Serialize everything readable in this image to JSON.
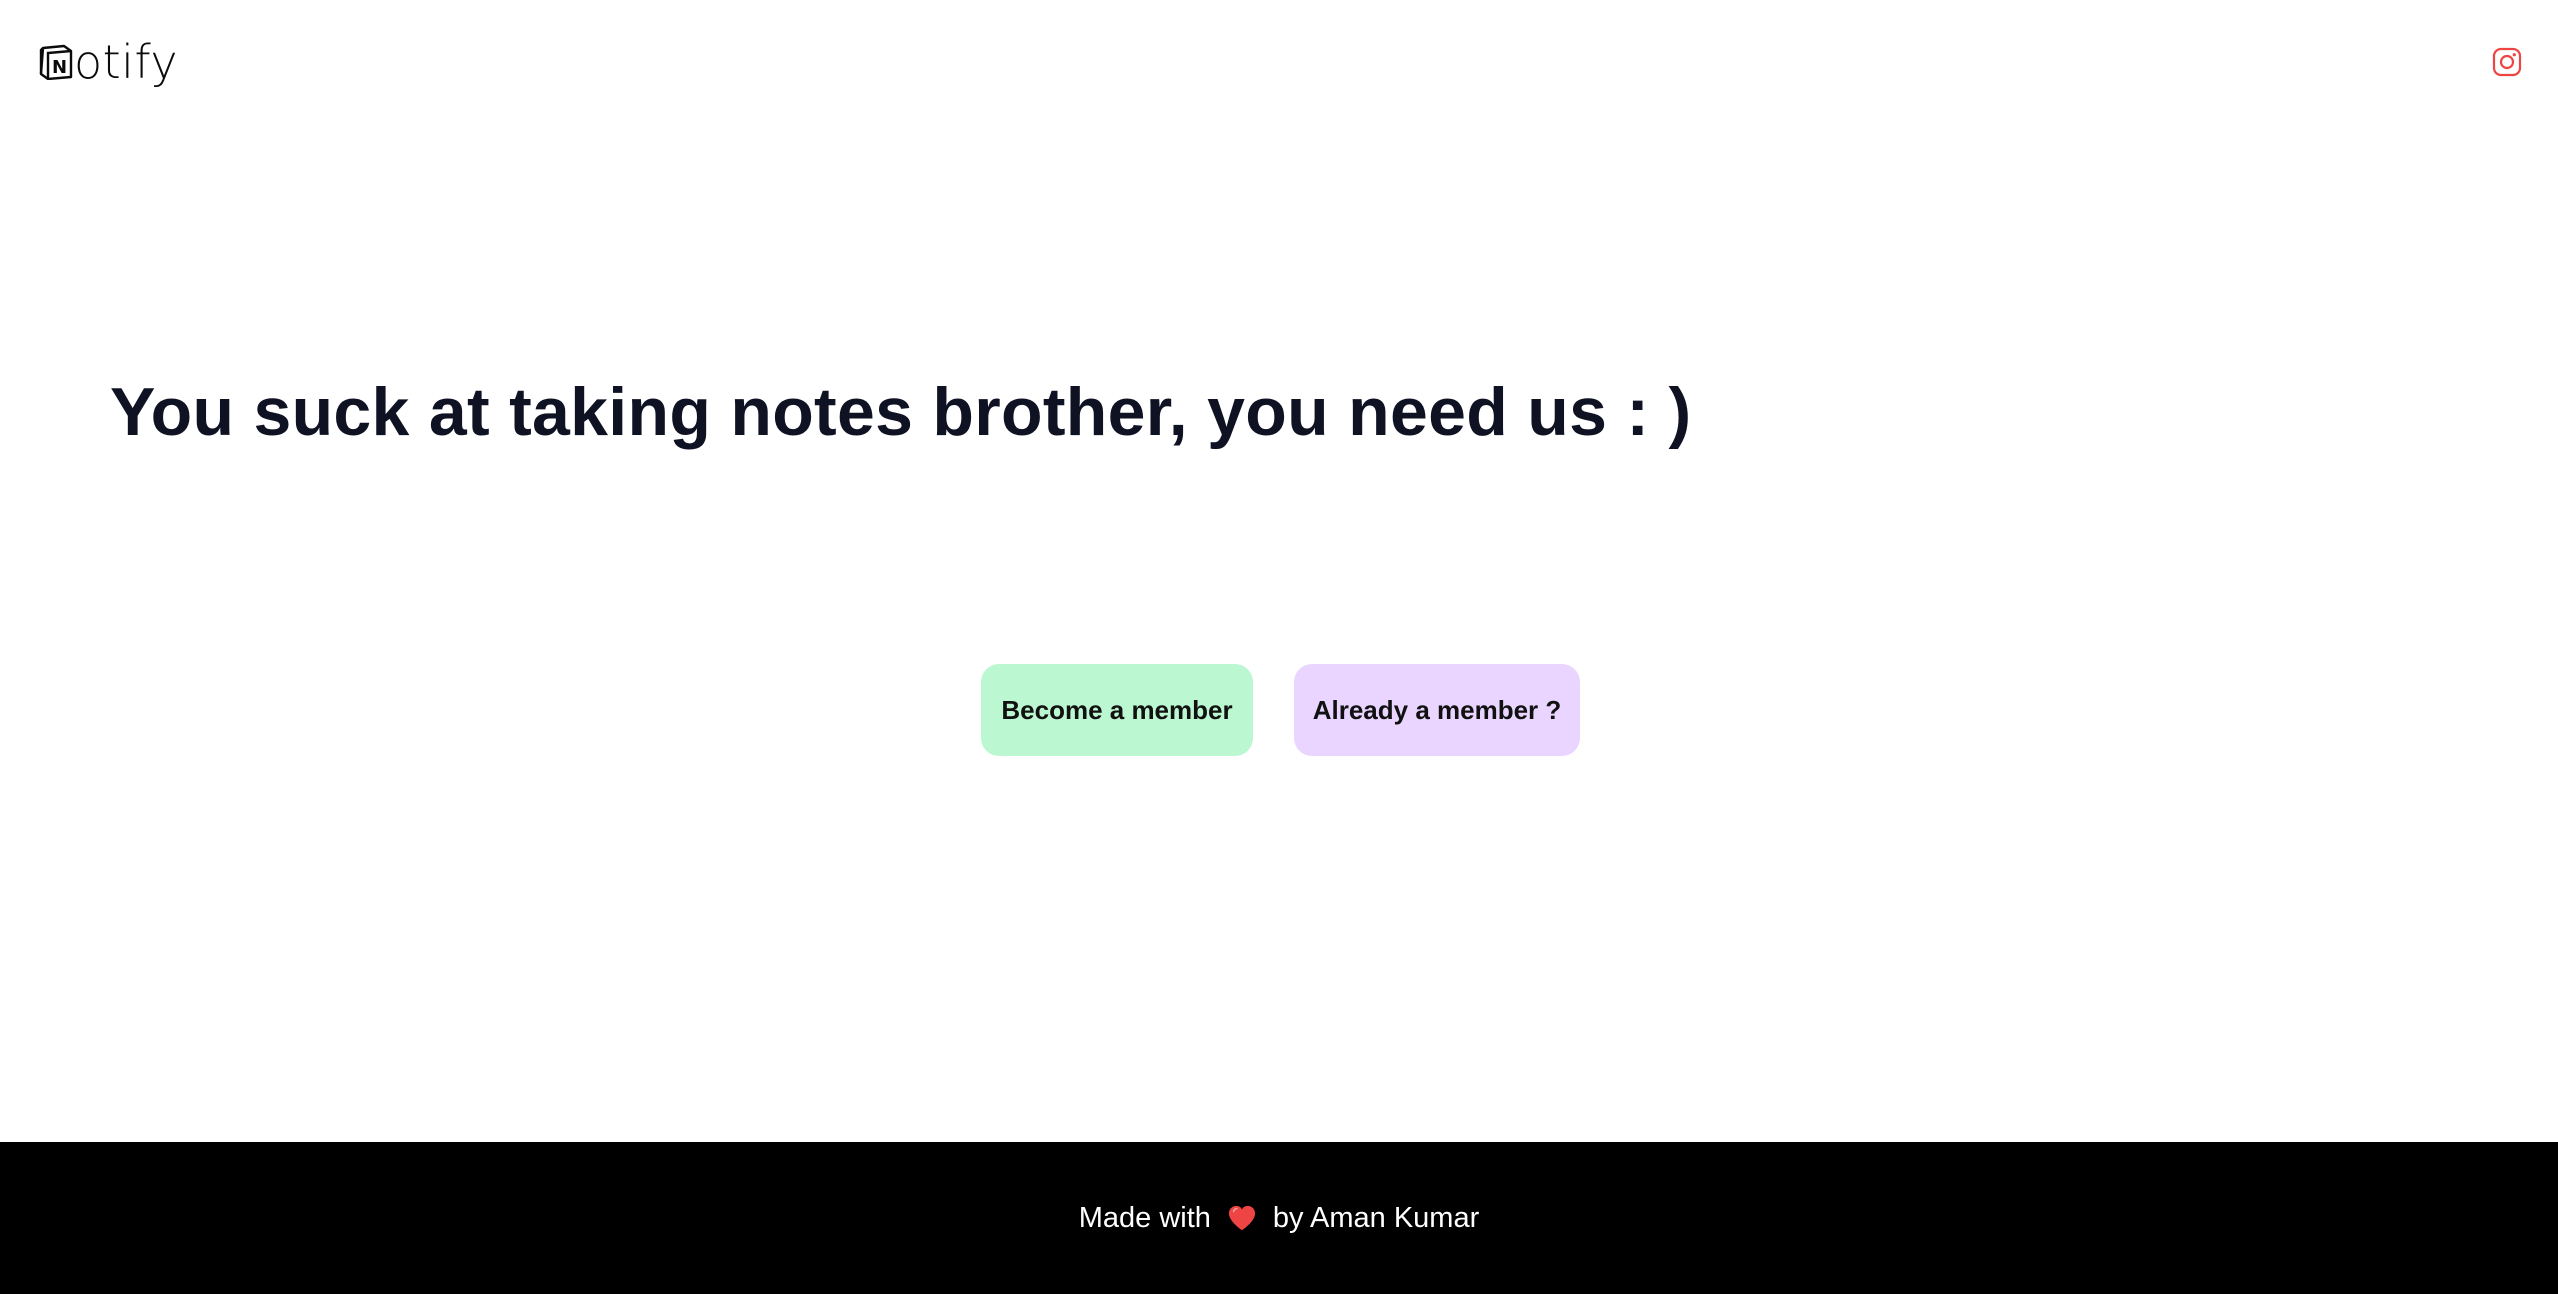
{
  "nav": {
    "logo_text": "otify",
    "logo_mark_letter": "N",
    "social_icon": "instagram-icon",
    "social_color": "#ef4444"
  },
  "hero": {
    "title": "You suck at taking notes brother, you need us : )"
  },
  "actions": {
    "join_label": "Become a member",
    "join_color": "#bbf7d0",
    "login_label": "Already a member ?",
    "login_color": "#e9d5ff"
  },
  "footer": {
    "prefix": "Made with",
    "heart_icon": "heart-icon",
    "heart_color": "#ef4444",
    "suffix": "by Aman Kumar",
    "background": "#000000"
  }
}
